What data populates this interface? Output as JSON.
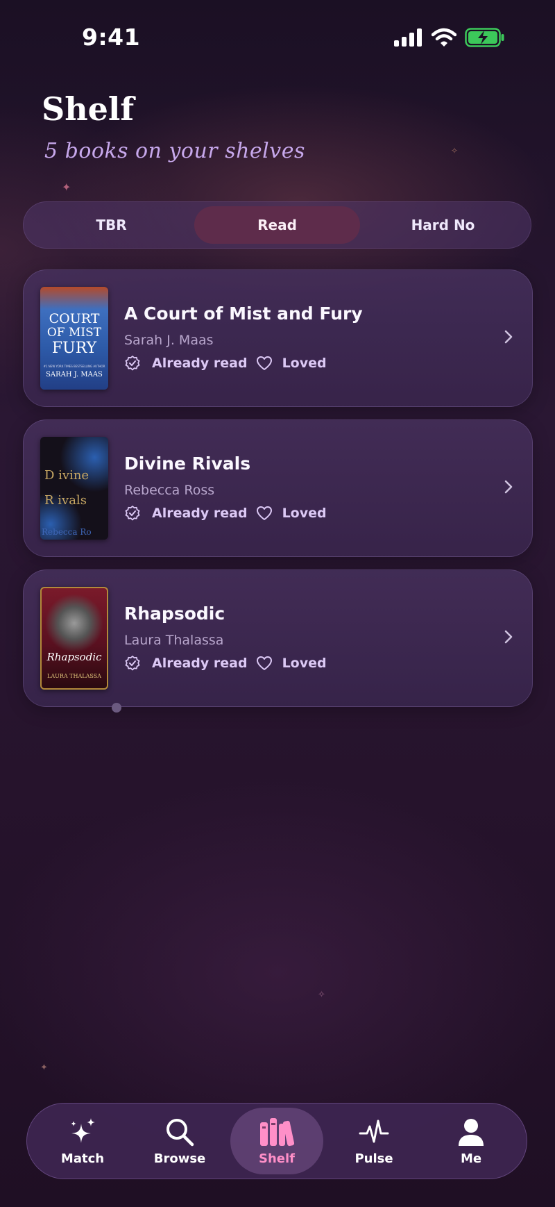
{
  "status_bar": {
    "time": "9:41"
  },
  "header": {
    "title": "Shelf",
    "subtitle": "5 books on your shelves"
  },
  "tabs": [
    {
      "label": "TBR",
      "active": false
    },
    {
      "label": "Read",
      "active": true
    },
    {
      "label": "Hard No",
      "active": false
    }
  ],
  "books": [
    {
      "title": "A Court of Mist and Fury",
      "author": "Sarah J. Maas",
      "status": "Already read",
      "reaction": "Loved",
      "cover": {
        "line1": "COURT",
        "line2": "OF MIST",
        "line3": "FURY",
        "author": "SARAH J. MAAS",
        "tagline": "#1 NEW YORK TIMES BESTSELLING AUTHOR"
      }
    },
    {
      "title": "Divine Rivals",
      "author": "Rebecca Ross",
      "status": "Already read",
      "reaction": "Loved",
      "cover": {
        "line1": "D ivine",
        "line2": "R ivals",
        "author": "Rebecca Ro"
      }
    },
    {
      "title": "Rhapsodic",
      "author": "Laura Thalassa",
      "status": "Already read",
      "reaction": "Loved",
      "cover": {
        "line1": "Rhapsodic",
        "author": "LAURA THALASSA"
      }
    }
  ],
  "nav": [
    {
      "label": "Match",
      "icon": "sparkles-icon",
      "active": false
    },
    {
      "label": "Browse",
      "icon": "search-icon",
      "active": false
    },
    {
      "label": "Shelf",
      "icon": "books-icon",
      "active": true
    },
    {
      "label": "Pulse",
      "icon": "pulse-icon",
      "active": false
    },
    {
      "label": "Me",
      "icon": "person-icon",
      "active": false
    }
  ],
  "colors": {
    "accent": "#ff8fc8",
    "active_tab": "#5e2c4b",
    "subtitle": "#c7a8ec",
    "battery": "#3cc85a"
  }
}
